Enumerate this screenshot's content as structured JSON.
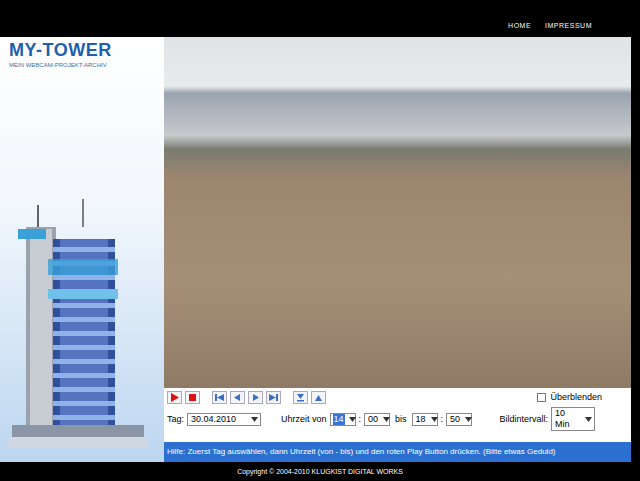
{
  "nav": [
    {
      "label": "HOME"
    },
    {
      "label": "IMPRESSUM"
    }
  ],
  "logo": {
    "title": "MY-TOWER",
    "subtitle": "MEIN WEBCAM-PROJEKT-ARCHIV"
  },
  "crossfade": {
    "label": "Überblenden",
    "checked": false
  },
  "day": {
    "label": "Tag:",
    "value": "30.04.2010"
  },
  "time": {
    "label": "Uhrzeit von",
    "from_hour": "14",
    "from_hour_highlighted": true,
    "separator": ":",
    "from_minute": "00",
    "to_label": "bis",
    "to_hour": "18",
    "to_minute": "50"
  },
  "interval": {
    "label": "Bildintervall:",
    "value": "10 Min"
  },
  "help": "Hilfe: Zuerst Tag auswählen, dann Uhrzeit (von - bis) und den roten Play Button drücken. (Bitte etwas Geduld)",
  "footer": "Copyright © 2004-2010 KLUGKIST DIGITAL WORKS"
}
